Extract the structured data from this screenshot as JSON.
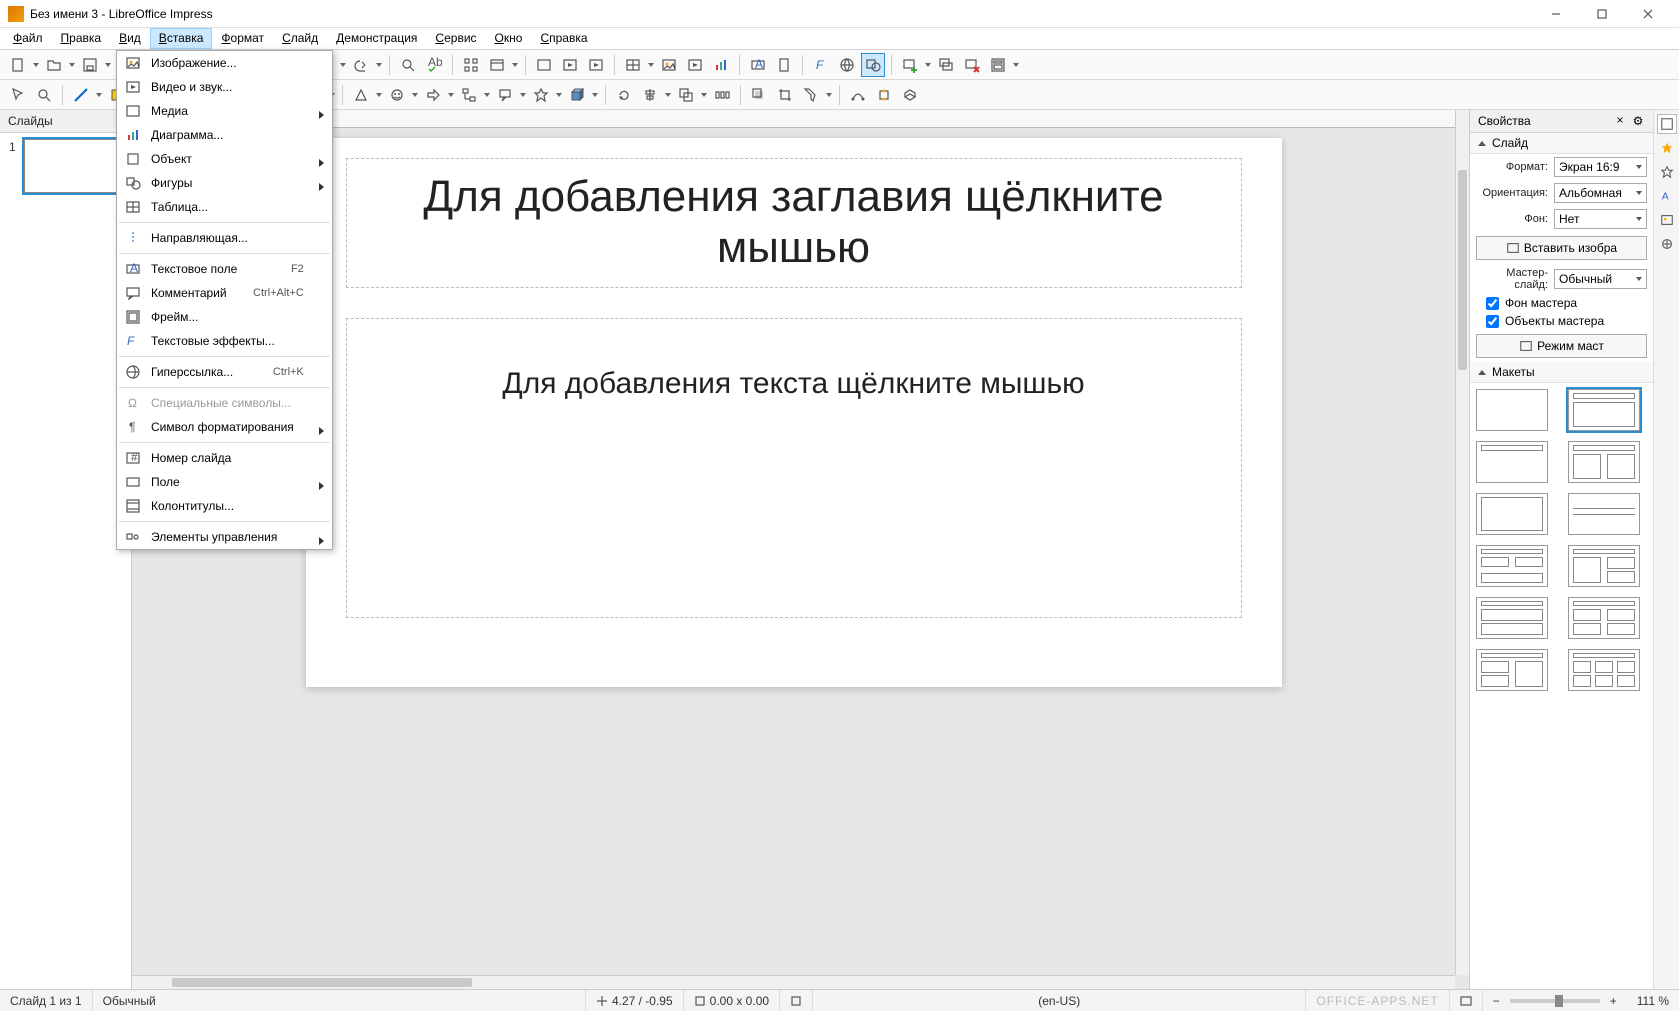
{
  "window": {
    "title": "Без имени 3 - LibreOffice Impress"
  },
  "menubar": {
    "items": [
      "Файл",
      "Правка",
      "Вид",
      "Вставка",
      "Формат",
      "Слайд",
      "Демонстрация",
      "Сервис",
      "Окно",
      "Справка"
    ],
    "active_index": 3
  },
  "insert_menu": {
    "items": [
      {
        "label": "Изображение...",
        "icon": "image"
      },
      {
        "label": "Видео и звук...",
        "icon": "media"
      },
      {
        "label": "Медиа",
        "icon": "media2",
        "submenu": true
      },
      {
        "label": "Диаграмма...",
        "icon": "chart"
      },
      {
        "label": "Объект",
        "icon": "object",
        "submenu": true
      },
      {
        "label": "Фигуры",
        "icon": "shapes",
        "submenu": true
      },
      {
        "label": "Таблица...",
        "icon": "table"
      },
      {
        "sep": true
      },
      {
        "label": "Направляющая...",
        "icon": "guide"
      },
      {
        "sep": true
      },
      {
        "label": "Текстовое поле",
        "icon": "textbox",
        "shortcut": "F2"
      },
      {
        "label": "Комментарий",
        "icon": "comment",
        "shortcut": "Ctrl+Alt+C"
      },
      {
        "label": "Фрейм...",
        "icon": "frame"
      },
      {
        "label": "Текстовые эффекты...",
        "icon": "fontwork"
      },
      {
        "sep": true
      },
      {
        "label": "Гиперссылка...",
        "icon": "hyperlink",
        "shortcut": "Ctrl+K"
      },
      {
        "sep": true
      },
      {
        "label": "Специальные символы...",
        "icon": "specialchar",
        "disabled": true
      },
      {
        "label": "Символ форматирования",
        "icon": "formattingmark",
        "submenu": true
      },
      {
        "sep": true
      },
      {
        "label": "Номер слайда",
        "icon": "slidenumber"
      },
      {
        "label": "Поле",
        "icon": "field",
        "submenu": true
      },
      {
        "label": "Колонтитулы...",
        "icon": "headerfooter"
      },
      {
        "sep": true
      },
      {
        "label": "Элементы управления",
        "icon": "formcontrols",
        "submenu": true
      }
    ]
  },
  "left_panel": {
    "title": "Слайды",
    "slides": [
      {
        "number": "1"
      }
    ]
  },
  "slide": {
    "title_placeholder": "Для добавления заглавия щёлкните мышью",
    "content_placeholder": "Для добавления текста щёлкните мышью"
  },
  "right_panel": {
    "title": "Свойства",
    "section_slide": "Слайд",
    "format_label": "Формат:",
    "format_value": "Экран 16:9",
    "orientation_label": "Ориентация:",
    "orientation_value": "Альбомная",
    "background_label": "Фон:",
    "background_value": "Нет",
    "insert_image_btn": "Вставить изобра",
    "master_label": "Мастер-слайд:",
    "master_value": "Обычный",
    "chk_master_bg": "Фон мастера",
    "chk_master_objects": "Объекты мастера",
    "master_mode_btn": "Режим маст",
    "section_layouts": "Макеты"
  },
  "statusbar": {
    "slide_info": "Слайд 1 из 1",
    "master": "Обычный",
    "coords": "4.27 / -0.95",
    "size": "0.00 x 0.00",
    "lang": "(en-US)",
    "zoom": "111 %",
    "watermark": "OFFICE-APPS.NET"
  }
}
